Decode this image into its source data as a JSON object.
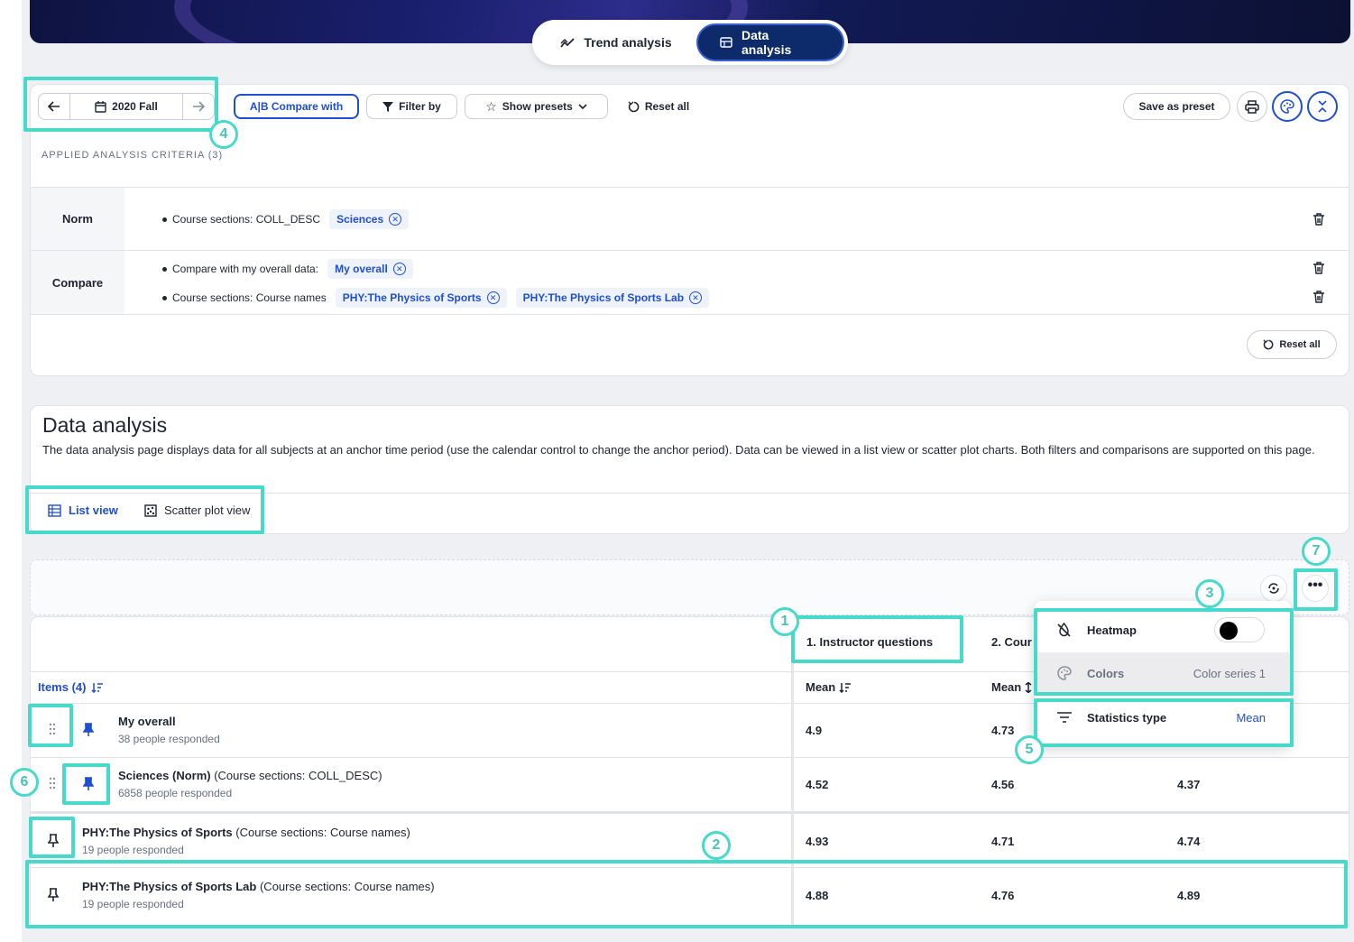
{
  "header": {
    "tabs": [
      {
        "label": "Trend analysis",
        "active": false
      },
      {
        "label": "Data analysis",
        "active": true
      }
    ]
  },
  "toolbar": {
    "period": "2020 Fall",
    "compare_label": "A|B Compare with",
    "filter_label": "Filter by",
    "presets_label": "Show presets",
    "reset_label": "Reset all",
    "save_preset_label": "Save as preset"
  },
  "criteria": {
    "label": "APPLIED ANALYSIS CRITERIA (3)",
    "norm": {
      "heading": "Norm",
      "line_label": "Course sections: COLL_DESC",
      "chips": [
        "Sciences"
      ]
    },
    "compare": {
      "heading": "Compare",
      "line1_label": "Compare with my overall data:",
      "line1_chips": [
        "My overall"
      ],
      "line2_label": "Course sections: Course names",
      "line2_chips": [
        "PHY:The Physics of Sports",
        "PHY:The Physics of Sports Lab"
      ]
    },
    "reset_label": "Reset all"
  },
  "data_analysis": {
    "title": "Data analysis",
    "description": "The data analysis page displays data for all subjects at an anchor time period (use the calendar control to change the anchor period). Data can be viewed in a list view or scatter plot charts. Both filters and comparisons are supported on this page.",
    "views": [
      "List view",
      "Scatter plot view"
    ]
  },
  "table": {
    "items_header": "Items (4)",
    "columns": [
      "1. Instructor questions",
      "2. Cour"
    ],
    "stat_headers": [
      "Mean",
      "Mean"
    ],
    "rows": [
      {
        "title": "My overall",
        "extra": "",
        "sub": "38 people responded",
        "values": [
          "4.9",
          "4.73",
          ""
        ]
      },
      {
        "title": "Sciences (Norm)",
        "extra": " (Course sections: COLL_DESC)",
        "sub": "6858 people responded",
        "values": [
          "4.52",
          "4.56",
          "4.37"
        ]
      },
      {
        "title": "PHY:The Physics of Sports",
        "extra": " (Course sections: Course names)",
        "sub": "19 people responded",
        "values": [
          "4.93",
          "4.71",
          "4.74"
        ]
      },
      {
        "title": "PHY:The Physics of Sports Lab",
        "extra": " (Course sections: Course names)",
        "sub": "19 people responded",
        "values": [
          "4.88",
          "4.76",
          "4.89"
        ]
      }
    ]
  },
  "popover": {
    "heatmap_label": "Heatmap",
    "colors_label": "Colors",
    "colors_value": "Color series 1",
    "stats_label": "Statistics type",
    "stats_value": "Mean"
  },
  "callouts": [
    "1",
    "2",
    "3",
    "4",
    "5",
    "6",
    "7"
  ],
  "colors": {
    "accent": "#1f4fd1",
    "highlight": "#47d9c9",
    "navy": "#0d2a6b"
  }
}
